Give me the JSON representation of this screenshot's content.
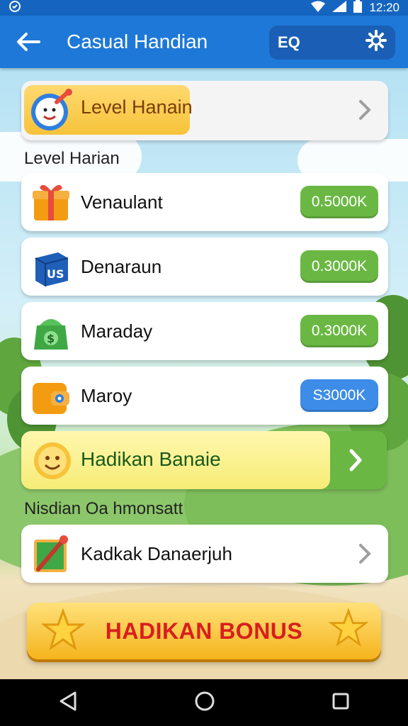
{
  "status": {
    "time": "12:20"
  },
  "appbar": {
    "title": "Casual Handian",
    "search_label": "EQ"
  },
  "header_card": {
    "label": "Level Hanain"
  },
  "section1": {
    "label": "Level Harian"
  },
  "rows": [
    {
      "label": "Venaulant",
      "value": "0.5000K",
      "color": "green"
    },
    {
      "label": "Denaraun",
      "value": "0.3000K",
      "color": "green"
    },
    {
      "label": "Maraday",
      "value": "0.3000K",
      "color": "green"
    },
    {
      "label": "Maroy",
      "value": "S3000K",
      "color": "blue"
    }
  ],
  "bonus_row": {
    "label": "Hadikan Banaie"
  },
  "section2": {
    "label": "Nisdian Oa hmonsatt"
  },
  "extra_card": {
    "label": "Kadkak Danaerjuh"
  },
  "bonus_button": {
    "label": "HADIKAN BONUS"
  },
  "colors": {
    "appbar": "#1e78d8",
    "green": "#6ab843",
    "blue": "#3d8ce8",
    "bonus_text": "#d81e1e"
  }
}
